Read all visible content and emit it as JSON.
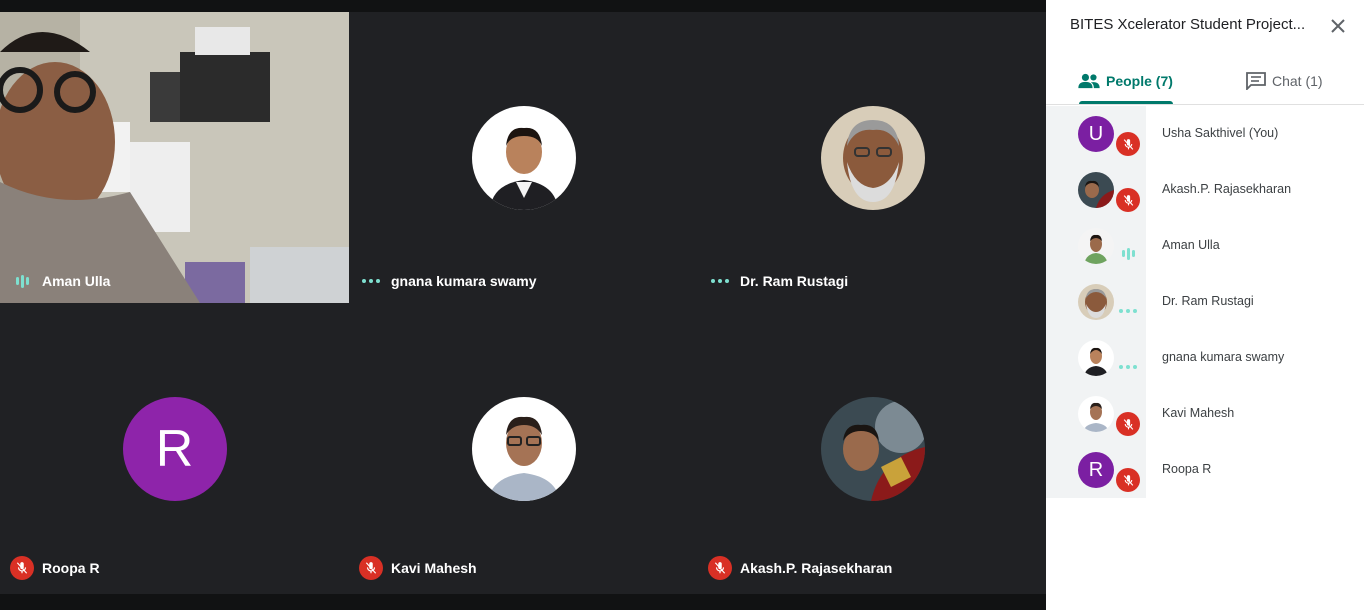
{
  "tiles": [
    {
      "name": "Aman Ulla",
      "status": "speaking"
    },
    {
      "name": "gnana kumara swamy",
      "status": "dots"
    },
    {
      "name": "Dr. Ram Rustagi",
      "status": "dots"
    },
    {
      "name": "Roopa R",
      "status": "muted",
      "avatar_letter": "R"
    },
    {
      "name": "Kavi Mahesh",
      "status": "muted"
    },
    {
      "name": "Akash.P. Rajasekharan",
      "status": "muted"
    }
  ],
  "panel": {
    "title": "BITES Xcelerator Student Project...",
    "tabs": {
      "people": "People (7)",
      "chat": "Chat (1)"
    },
    "people": [
      {
        "name": "Usha Sakthivel (You)",
        "avatar_letter": "U",
        "status": "muted"
      },
      {
        "name": "Akash.P. Rajasekharan",
        "status": "muted"
      },
      {
        "name": "Aman Ulla",
        "status": "speaking"
      },
      {
        "name": "Dr. Ram Rustagi",
        "status": "dots"
      },
      {
        "name": "gnana kumara swamy",
        "status": "dots"
      },
      {
        "name": "Kavi Mahesh",
        "status": "muted"
      },
      {
        "name": "Roopa R",
        "avatar_letter": "R",
        "status": "muted"
      }
    ]
  },
  "colors": {
    "accent": "#00796b",
    "muted_red": "#d93025",
    "avatar_purple": "#8e24aa",
    "teal_indicator": "#7ee0d0"
  }
}
